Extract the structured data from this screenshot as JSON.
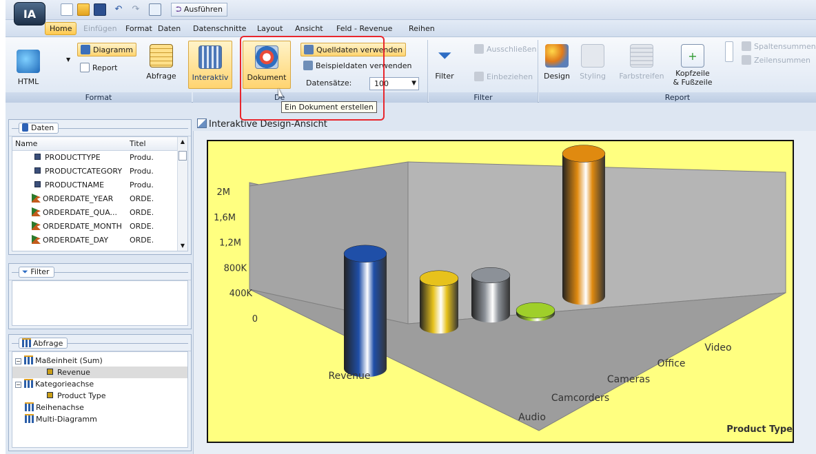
{
  "app": {
    "logo_text": "IA",
    "run_label": "Ausführen"
  },
  "menu": {
    "items": [
      {
        "label": "Home",
        "state": "active"
      },
      {
        "label": "Einfügen",
        "state": "disabled"
      },
      {
        "label": "Format",
        "state": "normal"
      },
      {
        "label": "Daten",
        "state": "normal"
      },
      {
        "label": "Datenschnitte",
        "state": "normal"
      },
      {
        "label": "Layout",
        "state": "normal"
      },
      {
        "label": "Ansicht",
        "state": "normal"
      },
      {
        "label": "Feld - Revenue",
        "state": "normal"
      },
      {
        "label": "Reihen",
        "state": "normal"
      }
    ]
  },
  "ribbon": {
    "format": {
      "html": "HTML",
      "diagramm": "Diagramm",
      "report": "Report",
      "abfrage": "Abfrage",
      "interaktiv": "Interaktiv",
      "dokument": "Dokument",
      "quelldaten": "Quelldaten verwenden",
      "beispieldaten": "Beispieldaten verwenden",
      "datensaetze_label": "Datensätze:",
      "datensaetze_value": "100",
      "group_label": "Format",
      "group2_label": "De"
    },
    "filter": {
      "filter": "Filter",
      "ausschliessen": "Ausschließen",
      "einbeziehen": "Einbeziehen",
      "group_label": "Filter"
    },
    "report": {
      "design": "Design",
      "styling": "Styling",
      "farbstreifen": "Farbstreifen",
      "kopfzeile_1": "Kopfzeile",
      "kopfzeile_2": "& Fußzeile",
      "spaltensummen": "Spaltensummen",
      "zeilensummen": "Zeilensummen",
      "group_label": "Report"
    }
  },
  "tooltip": "Ein Dokument erstellen",
  "daten": {
    "title": "Daten",
    "col_name": "Name",
    "col_titel": "Titel",
    "rows": [
      {
        "name": "PRODUCTTYPE",
        "titel": "Produ...",
        "kind": "dim"
      },
      {
        "name": "PRODUCTCATEGORY",
        "titel": "Produ...",
        "kind": "dim"
      },
      {
        "name": "PRODUCTNAME",
        "titel": "Produ...",
        "kind": "dim"
      },
      {
        "name": "ORDERDATE_YEAR",
        "titel": "ORDE...",
        "kind": "date"
      },
      {
        "name": "ORDERDATE_QUA...",
        "titel": "ORDE...",
        "kind": "date"
      },
      {
        "name": "ORDERDATE_MONTH",
        "titel": "ORDE...",
        "kind": "date"
      },
      {
        "name": "ORDERDATE_DAY",
        "titel": "ORDE...",
        "kind": "date"
      }
    ]
  },
  "filterpanel": {
    "title": "Filter"
  },
  "abfrage": {
    "title": "Abfrage",
    "items": [
      {
        "label": "Maßeinheit (Sum)",
        "level": 0,
        "icon": "bars",
        "expand": true
      },
      {
        "label": "Revenue",
        "level": 1,
        "icon": "sq",
        "selected": true
      },
      {
        "label": "Kategorieachse",
        "level": 0,
        "icon": "bars",
        "expand": true
      },
      {
        "label": "Product Type",
        "level": 1,
        "icon": "sq"
      },
      {
        "label": "Reihenachse",
        "level": 0,
        "icon": "bars"
      },
      {
        "label": "Multi-Diagramm",
        "level": 0,
        "icon": "bars"
      }
    ]
  },
  "canvas": {
    "title": "Interaktive Design-Ansicht"
  },
  "chart_data": {
    "type": "bar",
    "categories": [
      "Audio",
      "Camcorders",
      "Cameras",
      "Office",
      "Video"
    ],
    "series": [
      {
        "name": "Revenue",
        "values": [
          1450000,
          600000,
          500000,
          40000,
          1800000
        ]
      }
    ],
    "ylim": [
      0,
      2000000
    ],
    "yticks": [
      "0",
      "400K",
      "800K",
      "1,2M",
      "1,6M",
      "2M"
    ],
    "xlabel": "Revenue",
    "zlabel": "Product Type",
    "colors": [
      "#1f4fa8",
      "#e7c21c",
      "#8c9198",
      "#9fcf2a",
      "#e08a10"
    ],
    "background": "#ffff80"
  }
}
